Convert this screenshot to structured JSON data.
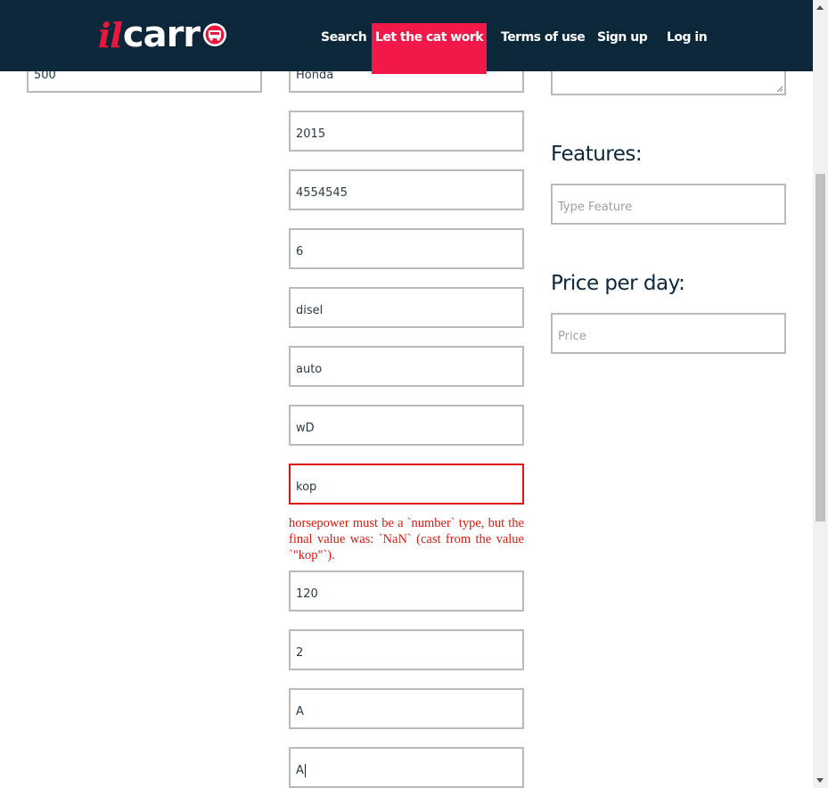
{
  "header": {
    "logo_il": "il",
    "logo_carr": "carr",
    "nav": {
      "search": "Search",
      "let_cat_work": "Let the cat work",
      "terms": "Terms of use",
      "signup": "Sign up",
      "login": "Log in"
    },
    "colors": {
      "background": "#0b2739",
      "accent": "#f2194a"
    }
  },
  "left_column": {
    "distance_value": "500"
  },
  "middle_column": {
    "make": "Honda",
    "year": "2015",
    "field_3": "4554545",
    "field_4": "6",
    "fuel": "disel",
    "gear": "auto",
    "wheels_drive": "wD",
    "horsepower": "kop",
    "horsepower_error": "horsepower must be a `number` type, but the final value was: `NaN` (cast from the value `\"kop\"`).",
    "field_9": "120",
    "field_10": "2",
    "field_11": "A",
    "field_12": "A"
  },
  "right_column": {
    "features_title": "Features:",
    "feature_placeholder": "Type Feature",
    "price_title": "Price per day:",
    "price_placeholder": "Price"
  },
  "colors": {
    "error": "#e21111",
    "border": "#bababa"
  }
}
